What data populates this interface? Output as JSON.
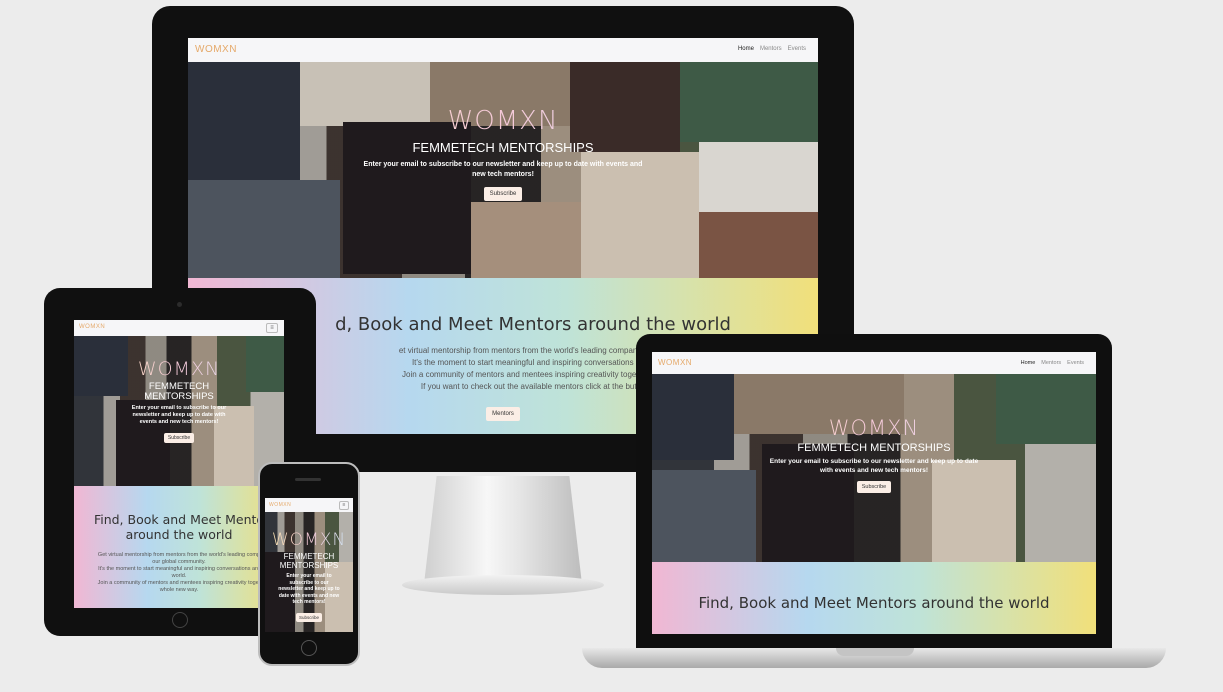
{
  "brand": {
    "logo": "WOMXN",
    "hero_title": "WOMXN",
    "hero_subtitle": "FEMMETECH MENTORSHIPS"
  },
  "nav": {
    "home": "Home",
    "mentors": "Mentors",
    "events": "Events",
    "menu_icon": "hamburger-icon"
  },
  "hero": {
    "tagline": "Enter your email to subscribe to our newsletter and keep up to date with events and new tech mentors!",
    "subscribe_label": "Subscribe"
  },
  "about": {
    "heading": "Find, Book and Meet Mentors around the world",
    "desktop_heading_visible": "d, Book and Meet Mentors around the world",
    "lines": [
      "et virtual mentorship from mentors from the world's leading companies in our glob",
      "It's the moment to start meaningful and inspiring conversations around the",
      "Join a community of mentors and mentees inspiring creativity together in a whol",
      "If you want to check out the available mentors click at the button belo"
    ],
    "tablet_heading_1": "Find, Book and Meet Mento",
    "tablet_heading_2": "around the world",
    "tablet_lines": [
      "Get virtual mentorship from mentors from the world's leading comp",
      "our global community.",
      "It's the moment to start meaningful and inspiring conversations aro",
      "world.",
      "Join a community of mentors and mentees inspiring creativity toget",
      "whole new way."
    ],
    "mentors_button": "Mentors"
  },
  "colors": {
    "bezel": "#0f0f0f",
    "band_pink": "#f1b7d3",
    "band_blue": "#b6d8ef",
    "band_yellow": "#f1e07a",
    "button_bg": "#fbeee6"
  }
}
